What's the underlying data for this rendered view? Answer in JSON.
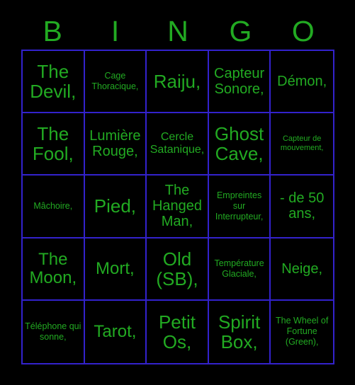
{
  "card": {
    "title": "BINGO",
    "colors": {
      "background": "#000000",
      "text": "#22aa22",
      "grid_line": "#3322cc"
    },
    "headers": [
      {
        "label": "B"
      },
      {
        "label": "I"
      },
      {
        "label": "N"
      },
      {
        "label": "G"
      },
      {
        "label": "O"
      }
    ],
    "cells": [
      {
        "text": "The Devil,",
        "size": "fs-xl"
      },
      {
        "text": "Cage Thoracique,",
        "size": "fs-xs"
      },
      {
        "text": "Raiju,",
        "size": "fs-xl"
      },
      {
        "text": "Capteur Sonore,",
        "size": "fs-md"
      },
      {
        "text": "Démon,",
        "size": "fs-md"
      },
      {
        "text": "The Fool,",
        "size": "fs-xl"
      },
      {
        "text": "Lumière Rouge,",
        "size": "fs-md"
      },
      {
        "text": "Cercle Satanique,",
        "size": "fs-sm"
      },
      {
        "text": "Ghost Cave,",
        "size": "fs-xl"
      },
      {
        "text": "Capteur de mouvement,",
        "size": "fs-xxs"
      },
      {
        "text": "Mâchoire,",
        "size": "fs-xs"
      },
      {
        "text": "Pied,",
        "size": "fs-xl"
      },
      {
        "text": "The Hanged Man,",
        "size": "fs-md"
      },
      {
        "text": "Empreintes sur Interrupteur,",
        "size": "fs-xs"
      },
      {
        "text": "- de 50 ans,",
        "size": "fs-md"
      },
      {
        "text": "The Moon,",
        "size": "fs-lg"
      },
      {
        "text": "Mort,",
        "size": "fs-lg"
      },
      {
        "text": "Old (SB),",
        "size": "fs-xl"
      },
      {
        "text": "Température Glaciale,",
        "size": "fs-xs"
      },
      {
        "text": "Neige,",
        "size": "fs-md"
      },
      {
        "text": "Téléphone qui sonne,",
        "size": "fs-xs"
      },
      {
        "text": "Tarot,",
        "size": "fs-lg"
      },
      {
        "text": "Petit Os,",
        "size": "fs-xl"
      },
      {
        "text": "Spirit Box,",
        "size": "fs-xl"
      },
      {
        "text": "The Wheel of Fortune (Green),",
        "size": "fs-xs"
      }
    ]
  }
}
